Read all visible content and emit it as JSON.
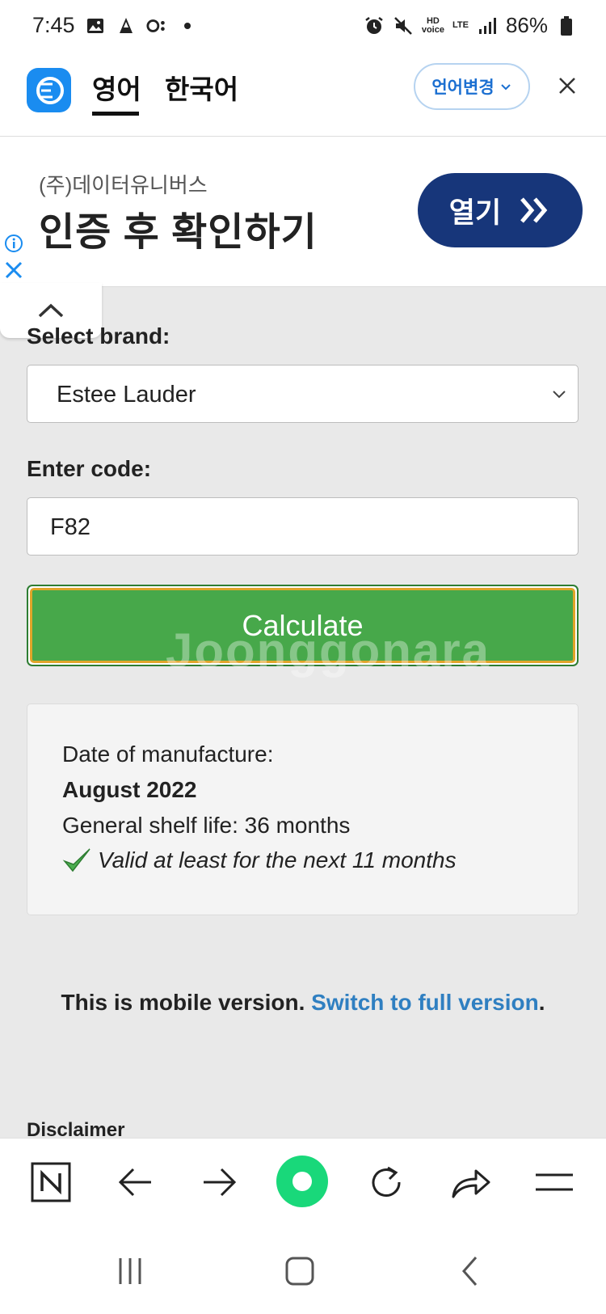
{
  "status_bar": {
    "time": "7:45",
    "battery": "86%",
    "hd_voice": "HD\nvoice",
    "lte": "LTE"
  },
  "translate_bar": {
    "tab_active": "영어",
    "tab_inactive": "한국어",
    "language_button": "언어변경"
  },
  "ad": {
    "company": "(주)데이터유니버스",
    "headline": "인증 후 확인하기",
    "button_label": "열기"
  },
  "form": {
    "brand_label": "Select brand:",
    "brand_value": "Estee Lauder",
    "code_label": "Enter code:",
    "code_value": "F82",
    "calculate_label": "Calculate"
  },
  "result": {
    "date_label": "Date of manufacture:",
    "date_value": "August 2022",
    "shelf_life": "General shelf life: 36 months",
    "validity": "Valid at least for the next 11 months"
  },
  "footer": {
    "mobile_text": "This is mobile version.",
    "switch_link": "Switch to full version",
    "period": ".",
    "disclaimer": "Disclaimer"
  },
  "watermark": "Joonggonara",
  "colors": {
    "calculate_green": "#47a84a",
    "ad_button": "#17367a",
    "link_blue": "#2f7fc1",
    "translate_blue": "#1a8cf0"
  }
}
